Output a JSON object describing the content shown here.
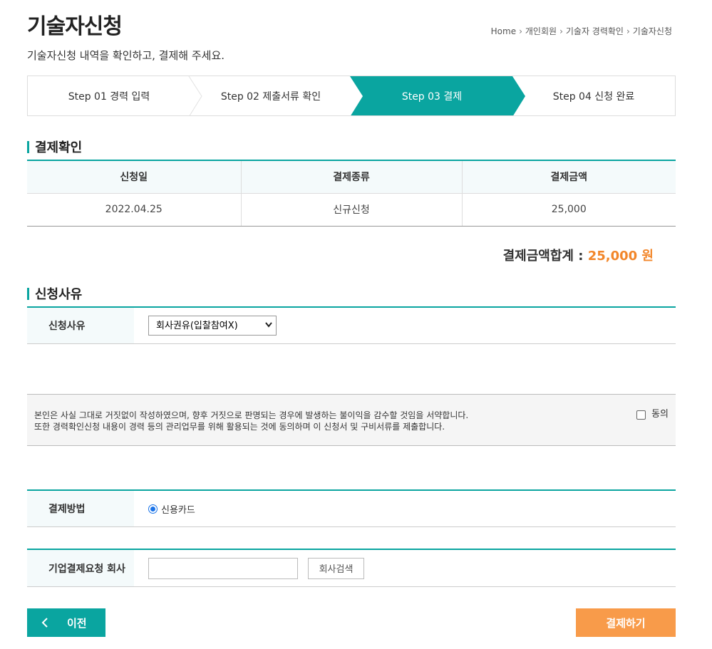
{
  "header": {
    "title": "기술자신청",
    "description": "기술자신청 내역을 확인하고, 결제해 주세요.",
    "breadcrumb": [
      "Home",
      "개인회원",
      "기술자 경력확인",
      "기술자신청"
    ]
  },
  "steps": [
    {
      "label": "Step 01 경력 입력",
      "active": false
    },
    {
      "label": "Step 02 제출서류 확인",
      "active": false
    },
    {
      "label": "Step 03 결제",
      "active": true
    },
    {
      "label": "Step 04 신청 완료",
      "active": false
    }
  ],
  "payment_confirm": {
    "heading": "결제확인",
    "columns": [
      "신청일",
      "결제종류",
      "결제금액"
    ],
    "row": {
      "date": "2022.04.25",
      "type": "신규신청",
      "amount": "25,000"
    },
    "total_label": "결제금액합계 :",
    "total_value": "25,000 원"
  },
  "reason": {
    "heading": "신청사유",
    "label": "신청사유",
    "selected": "회사권유(입찰참여X)"
  },
  "agreement": {
    "line1": "본인은 사실 그대로 거짓없이 작성하였으며, 향후 거짓으로 판명되는 경우에 발생하는 불이익을 감수할 것임을 서약합니다.",
    "line2": "또한 경력확인신청 내용이 경력 등의 관리업무를 위해 활용되는 것에 동의하며 이 신청서 및 구비서류를 제출합니다.",
    "checkbox_label": "동의"
  },
  "payment_method": {
    "label": "결제방법",
    "option": "신용카드"
  },
  "company": {
    "label": "기업결제요청 회사",
    "input_value": "",
    "search_button": "회사검색"
  },
  "buttons": {
    "prev": "이전",
    "pay": "결제하기"
  },
  "colors": {
    "accent": "#0aa5a0",
    "highlight": "#f2862a",
    "pay_button": "#f89b4a"
  }
}
